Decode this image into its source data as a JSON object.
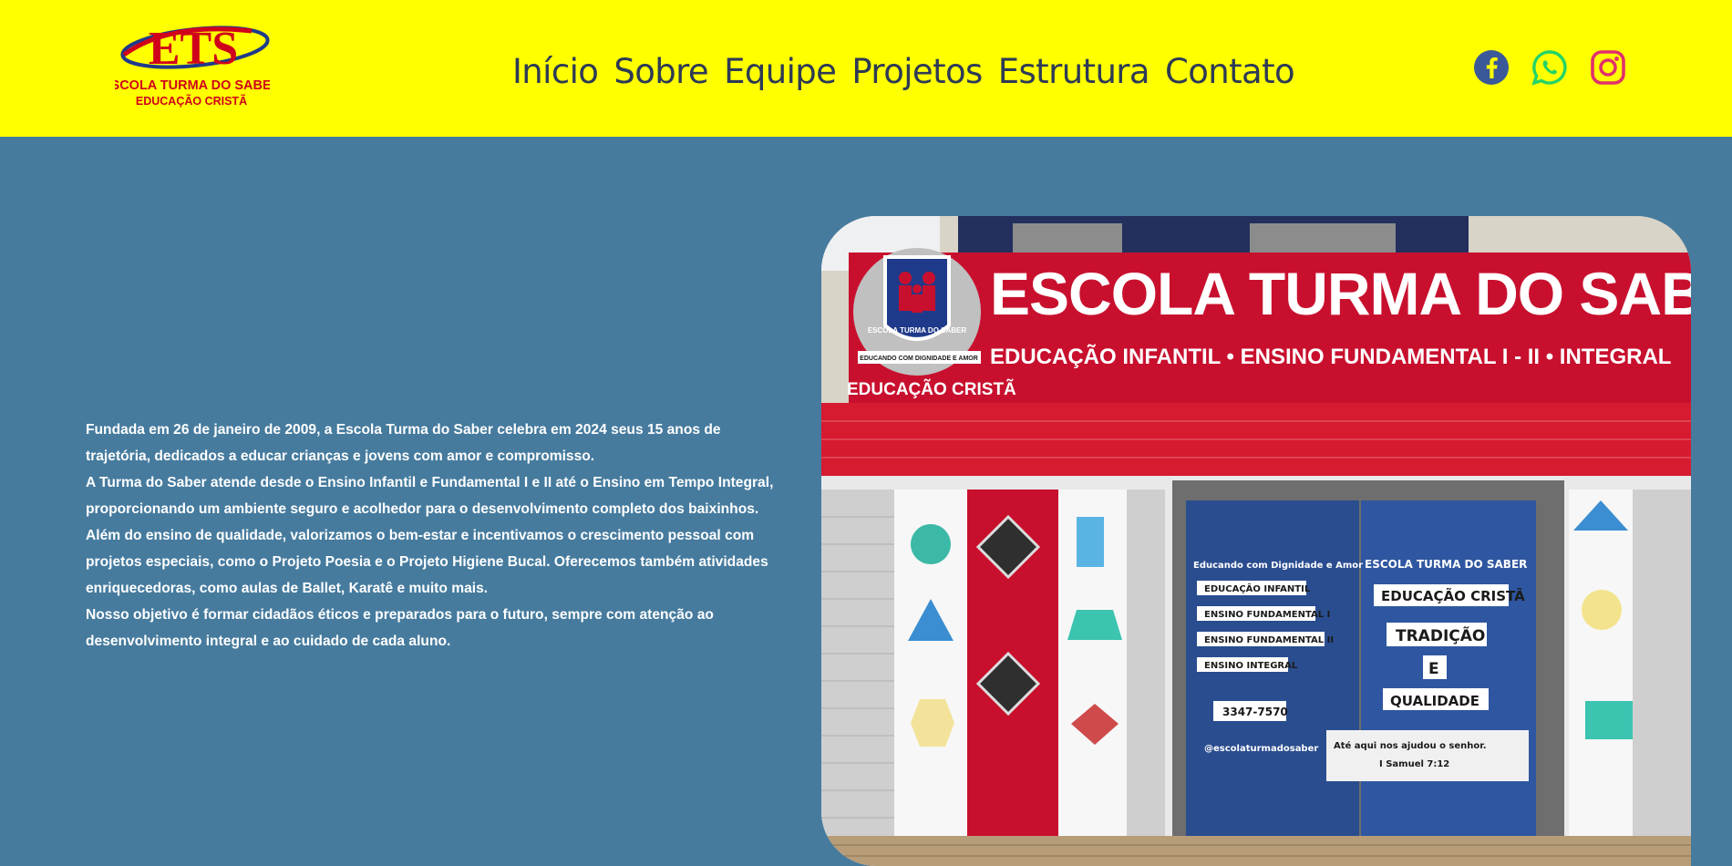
{
  "header": {
    "logo": {
      "letters": "ETS",
      "line1": "ESCOLA TURMA DO SABER",
      "line2": "EDUCAÇÃO CRISTÃ"
    },
    "nav": [
      "Início",
      "Sobre",
      "Equipe",
      "Projetos",
      "Estrutura",
      "Contato"
    ],
    "social": [
      {
        "icon": "facebook-icon",
        "color": "#3b5998"
      },
      {
        "icon": "whatsapp-icon",
        "color": "#25d366"
      },
      {
        "icon": "instagram-icon",
        "color": "#e1306c"
      }
    ]
  },
  "intro": {
    "paragraphs": [
      "Fundada em 26 de janeiro de 2009, a Escola Turma do Saber celebra em 2024 seus 15 anos de trajetória, dedicados a educar crianças e jovens com amor e compromisso.",
      "A Turma do Saber atende desde o Ensino Infantil e Fundamental I e II até o Ensino em Tempo Integral, proporcionando um ambiente seguro e acolhedor para o desenvolvimento completo dos baixinhos. Além do ensino de qualidade, valorizamos o bem-estar e incentivamos o crescimento pessoal com projetos especiais, como o Projeto Poesia e o Projeto Higiene Bucal. Oferecemos também atividades enriquecedoras, como aulas de Ballet, Karatê e muito mais.",
      "Nosso objetivo é formar cidadãos éticos e preparados para o futuro, sempre com atenção ao desenvolvimento integral e ao cuidado de cada aluno."
    ]
  },
  "photo": {
    "sign_title": "ESCOLA TURMA DO SABER",
    "sign_subtitle": "EDUCAÇÃO INFANTIL • ENSINO FUNDAMENTAL I - II • INTEGRAL",
    "sign_badge": "EDUCAÇÃO CRISTÃ",
    "crest_text": "ESCOLA TURMA DO SABER",
    "crest_motto": "EDUCANDO COM DIGNIDADE E AMOR",
    "door_left": [
      "Educando com Dignidade e Amor",
      "EDUCAÇÃO INFANTIL",
      "ENSINO FUNDAMENTAL I",
      "ENSINO FUNDAMENTAL II",
      "ENSINO INTEGRAL",
      "3347-7570",
      "@escolaturmadosaber"
    ],
    "door_right": [
      "ESCOLA TURMA DO SABER",
      "EDUCAÇÃO CRISTÃ",
      "TRADIÇÃO",
      "E",
      "QUALIDADE",
      "Até aqui nos ajudou o senhor.",
      "I Samuel 7:12"
    ]
  },
  "colors": {
    "header_bg": "#ffff00",
    "page_bg": "#467b9e",
    "nav_text": "#2d3a55",
    "sign_red": "#c8102e"
  }
}
